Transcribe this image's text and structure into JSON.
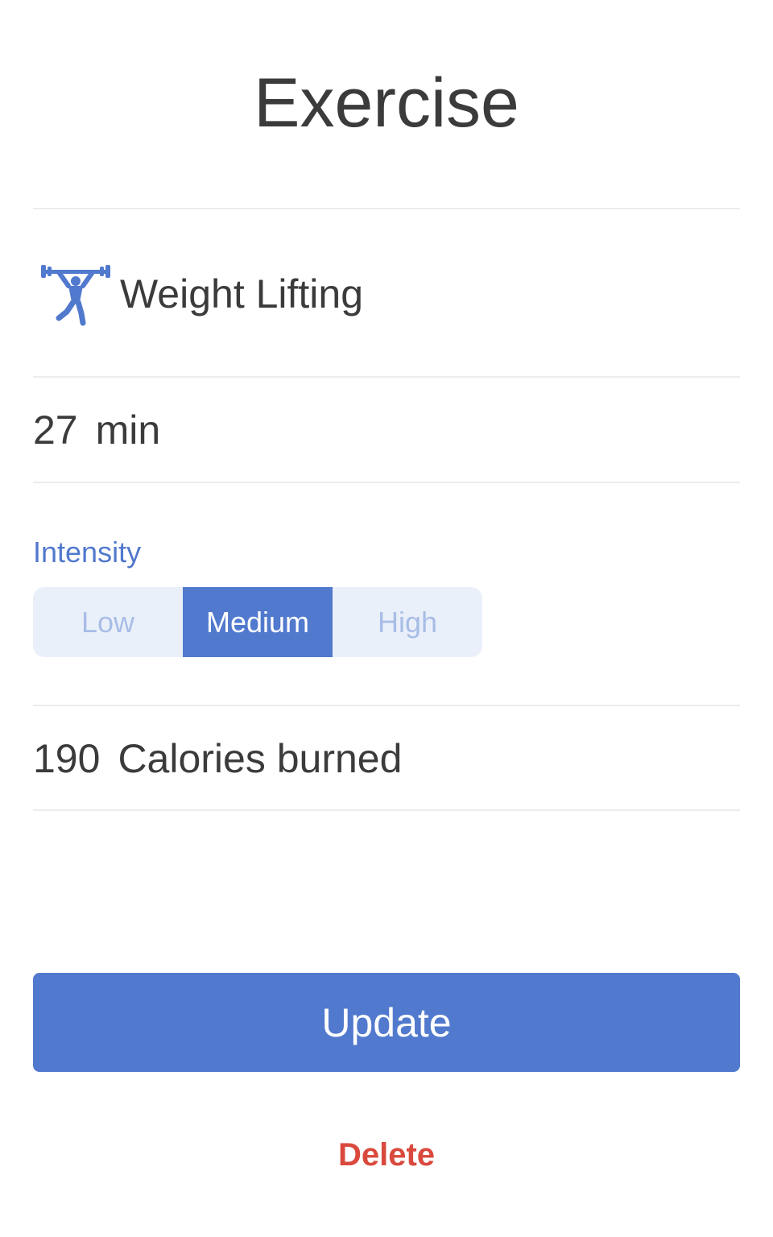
{
  "header": {
    "title": "Exercise"
  },
  "exercise": {
    "name": "Weight Lifting",
    "icon": "weight-lifting-icon",
    "icon_color": "#5179cd"
  },
  "duration": {
    "value": "27",
    "unit": "min"
  },
  "intensity": {
    "label": "Intensity",
    "options": [
      "Low",
      "Medium",
      "High"
    ],
    "selected": "Medium"
  },
  "calories": {
    "value": "190",
    "label": "Calories burned"
  },
  "actions": {
    "update_label": "Update",
    "delete_label": "Delete"
  },
  "colors": {
    "accent": "#5179cd",
    "segment_bg": "#eaf0fa",
    "segment_inactive_text": "#a8bde6",
    "danger": "#d9493d",
    "text": "#3b3b3b",
    "divider": "#ececec"
  }
}
